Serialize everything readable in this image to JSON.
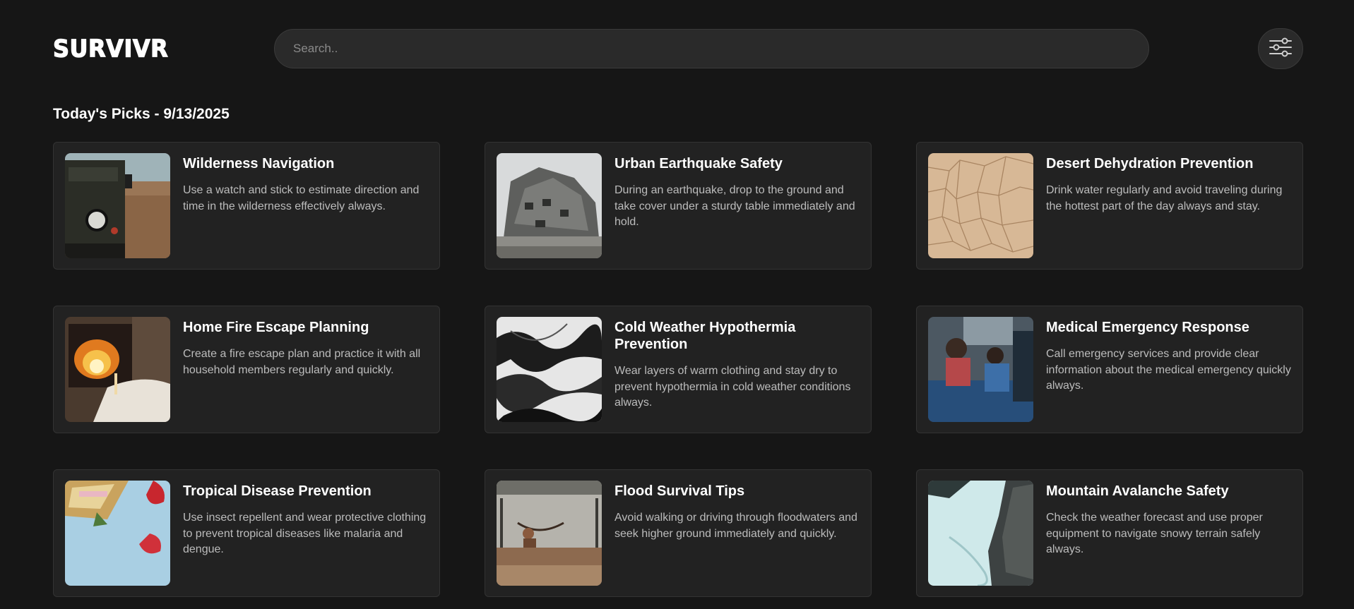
{
  "app": {
    "logo": "SURVIVR"
  },
  "search": {
    "placeholder": "Search.."
  },
  "filter": {
    "icon": "sliders-icon"
  },
  "section": {
    "title": "Today's Picks - 9/13/2025"
  },
  "cards": [
    {
      "title": "Wilderness Navigation",
      "description": "Use a watch and stick to estimate direction and time in the wilderness effectively always.",
      "image": "jeep-in-desert-image"
    },
    {
      "title": "Urban Earthquake Safety",
      "description": "During an earthquake, drop to the ground and take cover under a sturdy table immediately and hold.",
      "image": "collapsed-building-image"
    },
    {
      "title": "Desert Dehydration Prevention",
      "description": "Drink water regularly and avoid traveling during the hottest part of the day always and stay.",
      "image": "cracked-earth-image"
    },
    {
      "title": "Home Fire Escape Planning",
      "description": "Create a fire escape plan and practice it with all household members regularly and quickly.",
      "image": "fireplace-image"
    },
    {
      "title": "Cold Weather Hypothermia Prevention",
      "description": "Wear layers of warm clothing and stay dry to prevent hypothermia in cold weather conditions always.",
      "image": "frozen-terrain-image"
    },
    {
      "title": "Medical Emergency Response",
      "description": "Call emergency services and provide clear information about the medical emergency quickly always.",
      "image": "ambulance-interior-image"
    },
    {
      "title": "Tropical Disease Prevention",
      "description": "Use insect repellent and wear protective clothing to prevent tropical diseases like malaria and dengue.",
      "image": "tropical-fruit-image"
    },
    {
      "title": "Flood Survival Tips",
      "description": "Avoid walking or driving through floodwaters and seek higher ground immediately and quickly.",
      "image": "flooded-house-image"
    },
    {
      "title": "Mountain Avalanche Safety",
      "description": "Check the weather forecast and use proper equipment to navigate snowy terrain safely always.",
      "image": "snowy-mountain-image"
    }
  ]
}
